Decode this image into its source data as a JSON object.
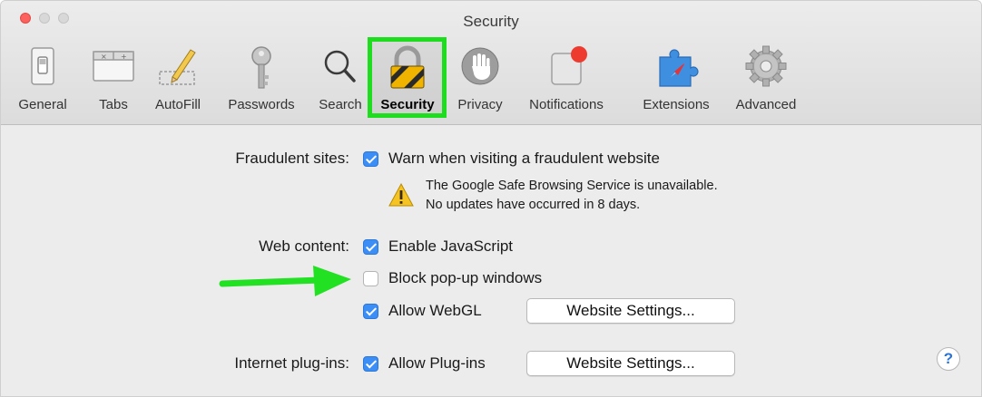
{
  "window": {
    "title": "Security"
  },
  "toolbar": {
    "tabs": [
      {
        "label": "General"
      },
      {
        "label": "Tabs"
      },
      {
        "label": "AutoFill"
      },
      {
        "label": "Passwords"
      },
      {
        "label": "Search"
      },
      {
        "label": "Security"
      },
      {
        "label": "Privacy"
      },
      {
        "label": "Notifications"
      },
      {
        "label": "Extensions"
      },
      {
        "label": "Advanced"
      }
    ],
    "selected_tab": "Security",
    "highlight_color": "#1edc1e"
  },
  "fraud": {
    "label": "Fraudulent sites:",
    "option": "Warn when visiting a fraudulent website",
    "checked": true,
    "warning_line1": "The Google Safe Browsing Service is unavailable.",
    "warning_line2": "No updates have occurred in 8 days."
  },
  "web_content": {
    "label": "Web content:",
    "js": "Enable JavaScript",
    "js_checked": true,
    "popups": "Block pop-up windows",
    "popups_checked": false,
    "webgl": "Allow WebGL",
    "webgl_checked": true,
    "webgl_button": "Website Settings..."
  },
  "plugins": {
    "label": "Internet plug-ins:",
    "option": "Allow Plug-ins",
    "checked": true,
    "button": "Website Settings..."
  },
  "help": {
    "symbol": "?"
  },
  "annotation": {
    "arrow_color": "#22e022"
  }
}
